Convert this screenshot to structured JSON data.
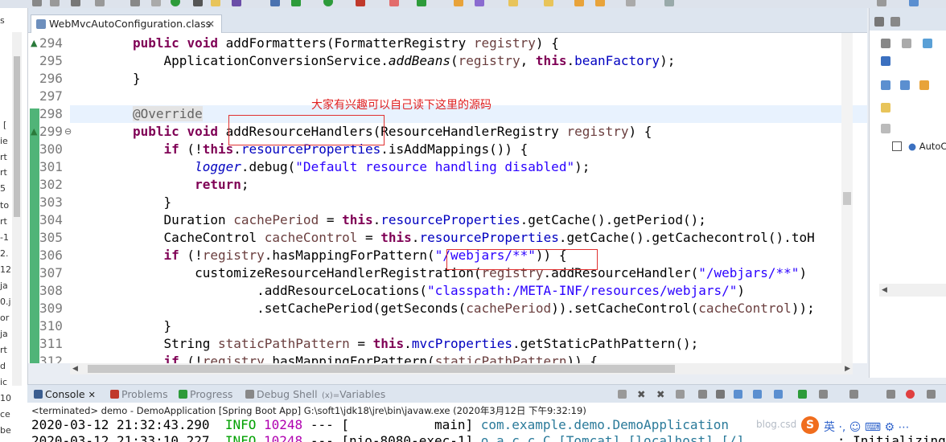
{
  "editor": {
    "tab_title": "WebMvcAutoConfiguration.class",
    "tab_close": "✕",
    "line_numbers": [
      "294",
      "295",
      "296",
      "297",
      "298",
      "299",
      "300",
      "301",
      "302",
      "303",
      "304",
      "305",
      "306",
      "307",
      "308",
      "309",
      "310",
      "311",
      "312"
    ],
    "annotation_text": "大家有兴趣可以自己读下这里的源码"
  },
  "left_panel": {
    "truncated_labels": [
      "s",
      "[",
      "ie",
      "rt",
      "rt",
      "5",
      "to",
      "rt",
      "-1",
      "2.",
      "12",
      "ja",
      "0.j",
      "or",
      "ja",
      "rt",
      "d",
      "ic",
      "10",
      "ce",
      "be"
    ]
  },
  "right_panel": {
    "outline_item": "AutoCo"
  },
  "console": {
    "tabs": [
      "Console",
      "Problems",
      "Progress",
      "Debug Shell",
      "Variables"
    ],
    "tab_prefix_variables": "(x)=",
    "terminated_line": "<terminated> demo - DemoApplication [Spring Boot App] G:\\soft1\\jdk18\\jre\\bin\\javaw.exe (2020年3月12日 下午9:32:19)",
    "log": [
      {
        "time": "2020-03-12 21:32:43.290",
        "level": "INFO",
        "pid": "10248",
        "sep": "---",
        "thread": "[           main]",
        "logger": "com.example.demo.DemoApplication"
      },
      {
        "time": "2020-03-12 21:33:10.227",
        "level": "INFO",
        "pid": "10248",
        "sep": "---",
        "thread": "[nio-8080-exec-1]",
        "logger": "o.a.c.c.C.[Tomcat].[localhost].[/]",
        "tail": ": Initializing"
      }
    ],
    "watermark": "blog.csd",
    "badge": "S",
    "ime_text": "英 ·, ☺ ⌨ ⚙ ⋯"
  }
}
